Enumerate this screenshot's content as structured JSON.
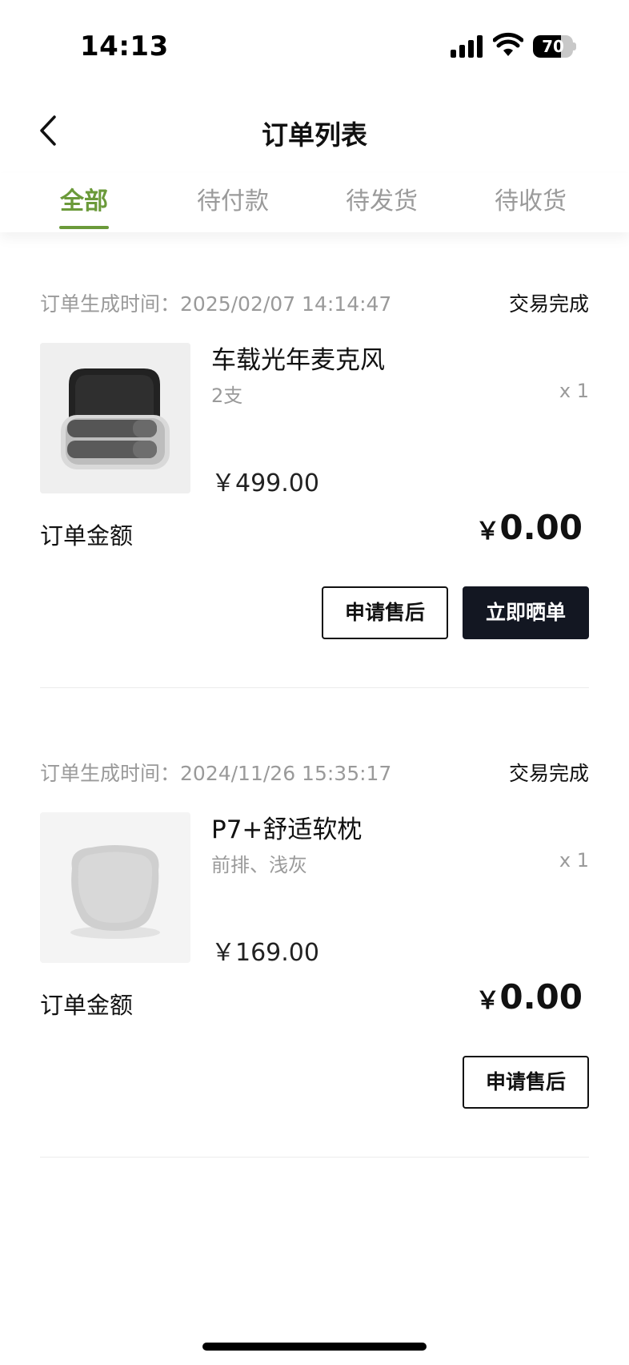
{
  "status_bar": {
    "time": "14:13",
    "battery_level": "70",
    "battery_fraction": 0.7
  },
  "nav": {
    "title": "订单列表",
    "back_icon": "chevron-left-icon"
  },
  "tabs": [
    {
      "label": "全部",
      "active": true
    },
    {
      "label": "待付款",
      "active": false
    },
    {
      "label": "待发货",
      "active": false
    },
    {
      "label": "待收货",
      "active": false
    }
  ],
  "colors": {
    "accent": "#6b9a3a",
    "primary_button": "#131722",
    "muted_text": "#9a9a9a"
  },
  "orders": [
    {
      "created_label": "订单生成时间：",
      "created_at": "2025/02/07 14:14:47",
      "status": "交易完成",
      "product_name": "车载光年麦克风",
      "product_spec": "2支",
      "quantity": "x 1",
      "price": "￥499.00",
      "amount_label": "订单金额",
      "amount_currency": "￥",
      "amount_value": "0.00",
      "buttons": [
        "申请售后",
        "立即晒单"
      ]
    },
    {
      "created_label": "订单生成时间：",
      "created_at": "2024/11/26 15:35:17",
      "status": "交易完成",
      "product_name": "P7+舒适软枕",
      "product_spec": "前排、浅灰",
      "quantity": "x 1",
      "price": "￥169.00",
      "amount_label": "订单金额",
      "amount_currency": "￥",
      "amount_value": "0.00",
      "buttons": [
        "申请售后"
      ]
    }
  ]
}
